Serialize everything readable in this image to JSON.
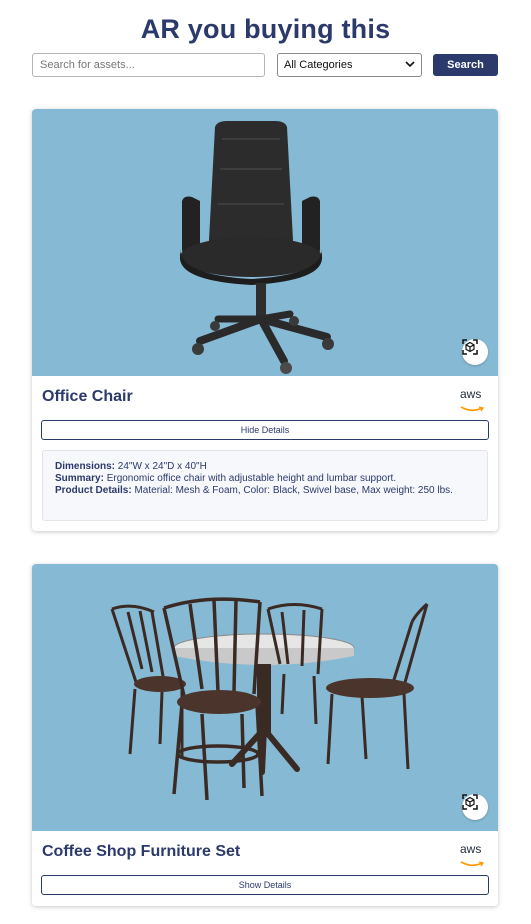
{
  "header": {
    "title": "AR you buying this"
  },
  "search": {
    "placeholder": "Search for assets...",
    "value": "",
    "button_label": "Search"
  },
  "filter": {
    "selected": "All Categories"
  },
  "colors": {
    "brand": "#2b3a6b",
    "image_bg": "#86b9d4"
  },
  "products": [
    {
      "title": "Office Chair",
      "provider": "aws",
      "details_button": "Hide Details",
      "details": {
        "dimensions_label": "Dimensions:",
        "dimensions": "24\"W x 24\"D x 40\"H",
        "summary_label": "Summary:",
        "summary": "Ergonomic office chair with adjustable height and lumbar support.",
        "product_details_label": "Product Details:",
        "product_details": "Material: Mesh & Foam, Color: Black, Swivel base, Max weight: 250 lbs."
      },
      "icons": {
        "ar": "ar-view-icon",
        "provider": "aws-logo"
      }
    },
    {
      "title": "Coffee Shop Furniture Set",
      "provider": "aws",
      "details_button": "Show Details",
      "icons": {
        "ar": "ar-view-icon",
        "provider": "aws-logo"
      }
    }
  ]
}
